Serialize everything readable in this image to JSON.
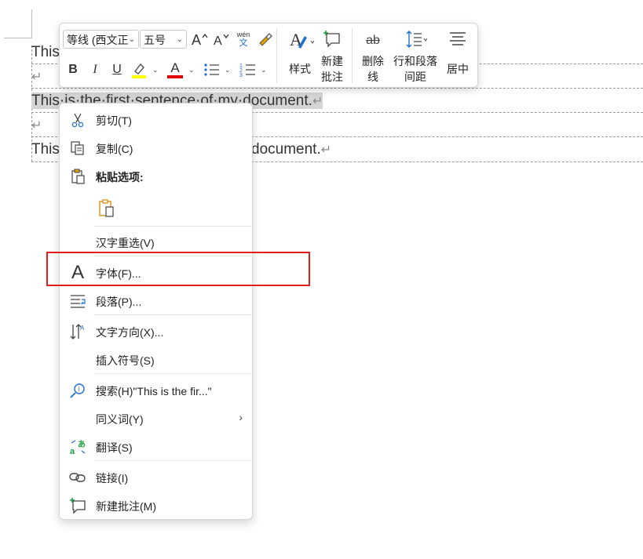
{
  "document": {
    "line1_visible": "This",
    "line3_text": "This·is·the·first·sentence·of·my·document.",
    "line5_start": "This",
    "line5_end": "document.",
    "para_mark": "↵"
  },
  "mini_toolbar": {
    "font_name": "等线 (西文正",
    "font_size": "五号",
    "grow_font": "A^",
    "shrink_font": "Aˇ",
    "phonetic_top": "wén",
    "phonetic_bottom": "文",
    "bold": "B",
    "italic": "I",
    "underline": "U",
    "font_color_letter": "A",
    "styles_label": "样式",
    "new_comment_label_1": "新建",
    "new_comment_label_2": "批注",
    "strike_label_1": "删除",
    "strike_label_2": "线",
    "strike_icon_text": "ab",
    "line_spacing_label_1": "行和段落",
    "line_spacing_label_2": "间距",
    "center_label": "居中",
    "colors": {
      "highlight": "#ffff00",
      "font_color": "#e00000"
    }
  },
  "context_menu": {
    "items": [
      {
        "label": "剪切(T)",
        "icon": "scissors-icon"
      },
      {
        "label": "复制(C)",
        "icon": "copy-icon"
      },
      {
        "label": "粘贴选项:",
        "icon": "paste-icon"
      },
      {
        "label": "",
        "icon": "paste-keep-text-icon"
      },
      {
        "label": "汉字重选(V)",
        "icon": ""
      },
      {
        "label": "字体(F)...",
        "icon": "font-icon"
      },
      {
        "label": "段落(P)...",
        "icon": "paragraph-icon"
      },
      {
        "label": "文字方向(X)...",
        "icon": "text-direction-icon"
      },
      {
        "label": "插入符号(S)",
        "icon": ""
      },
      {
        "label": "搜索(H)\"This is the fir...\"",
        "icon": "search-icon"
      },
      {
        "label": "同义词(Y)",
        "icon": ""
      },
      {
        "label": "翻译(S)",
        "icon": "translate-icon"
      },
      {
        "label": "链接(I)",
        "icon": "link-icon"
      },
      {
        "label": "新建批注(M)",
        "icon": "new-comment-icon"
      }
    ],
    "submenu_arrow": "›",
    "font_icon_glyph": "A"
  },
  "highlight_color": "#e01e1e"
}
